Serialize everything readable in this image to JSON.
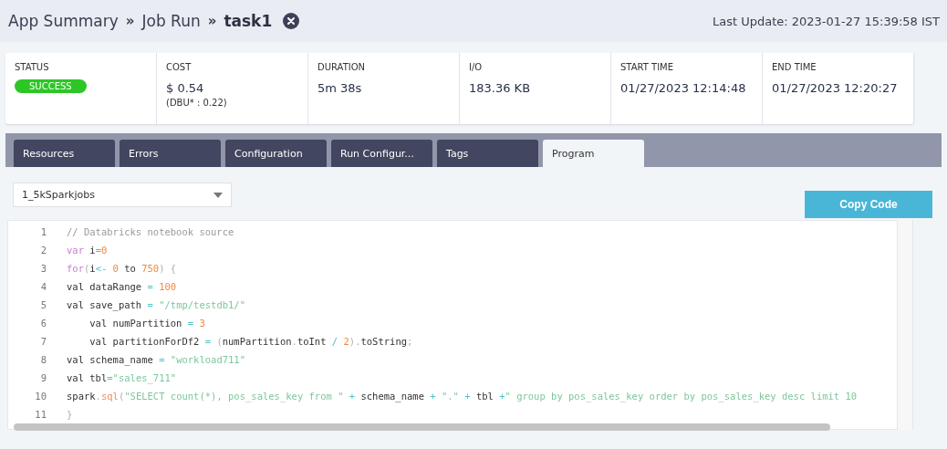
{
  "breadcrumb": [
    {
      "kind": "link",
      "text": "App Summary"
    },
    {
      "kind": "separator",
      "text": "»"
    },
    {
      "kind": "link",
      "text": "Job Run"
    },
    {
      "kind": "separator",
      "text": "»"
    },
    {
      "kind": "current",
      "text": "task1"
    }
  ],
  "last_update": "Last Update: 2023-01-27 15:39:58 IST",
  "stats": [
    {
      "kind": "badge",
      "label": "STATUS",
      "value": "SUCCESS",
      "color": "#2ec627"
    },
    {
      "kind": "text",
      "label": "COST",
      "value": "$ 0.54",
      "sub": "(DBU* : 0.22)"
    },
    {
      "kind": "text",
      "label": "DURATION",
      "value": "5m 38s"
    },
    {
      "kind": "text",
      "label": "I/O",
      "value": "183.36 KB"
    },
    {
      "kind": "text",
      "label": "START TIME",
      "value": "01/27/2023 12:14:48"
    },
    {
      "kind": "text",
      "label": "END TIME",
      "value": "01/27/2023 12:20:27"
    }
  ],
  "tabs": [
    {
      "label": "Resources",
      "selected": false
    },
    {
      "label": "Errors",
      "selected": false
    },
    {
      "label": "Configuration",
      "selected": false
    },
    {
      "label": "Run Configur...",
      "selected": false
    },
    {
      "label": "Tags",
      "selected": false
    },
    {
      "label": "Program",
      "selected": true
    }
  ],
  "program_select": {
    "value": "1_5kSparkjobs"
  },
  "copy_button": "Copy Code",
  "code_lines": [
    {
      "number": "1",
      "tokens": [
        {
          "kind": "comment",
          "text": "// Databricks notebook source"
        }
      ]
    },
    {
      "number": "2",
      "tokens": [
        {
          "kind": "keyword",
          "text": "var"
        },
        {
          "kind": "plain",
          "text": " i"
        },
        {
          "kind": "operator",
          "text": "="
        },
        {
          "kind": "number",
          "text": "0"
        }
      ]
    },
    {
      "number": "3",
      "tokens": [
        {
          "kind": "keyword",
          "text": "for"
        },
        {
          "kind": "punct",
          "text": "("
        },
        {
          "kind": "plain",
          "text": "i"
        },
        {
          "kind": "operator",
          "text": "<- "
        },
        {
          "kind": "number",
          "text": "0"
        },
        {
          "kind": "plain",
          "text": " to "
        },
        {
          "kind": "number",
          "text": "750"
        },
        {
          "kind": "punct",
          "text": ") {"
        }
      ]
    },
    {
      "number": "4",
      "tokens": [
        {
          "kind": "plain",
          "text": "val dataRange "
        },
        {
          "kind": "operator",
          "text": "= "
        },
        {
          "kind": "number",
          "text": "100"
        }
      ]
    },
    {
      "number": "5",
      "tokens": [
        {
          "kind": "plain",
          "text": "val save_path "
        },
        {
          "kind": "operator",
          "text": "= "
        },
        {
          "kind": "string",
          "text": "\"/tmp/testdb1/\""
        }
      ]
    },
    {
      "number": "6",
      "tokens": [
        {
          "kind": "plain",
          "text": "    val numPartition "
        },
        {
          "kind": "operator",
          "text": "= "
        },
        {
          "kind": "number",
          "text": "3"
        }
      ]
    },
    {
      "number": "7",
      "tokens": [
        {
          "kind": "plain",
          "text": "    val partitionForDf2 "
        },
        {
          "kind": "operator",
          "text": "= "
        },
        {
          "kind": "punct",
          "text": "("
        },
        {
          "kind": "plain",
          "text": "numPartition"
        },
        {
          "kind": "punct",
          "text": "."
        },
        {
          "kind": "plain",
          "text": "toInt "
        },
        {
          "kind": "operator",
          "text": "/ "
        },
        {
          "kind": "number",
          "text": "2"
        },
        {
          "kind": "punct",
          "text": ")."
        },
        {
          "kind": "plain",
          "text": "toString"
        },
        {
          "kind": "punct",
          "text": ";"
        }
      ]
    },
    {
      "number": "8",
      "tokens": [
        {
          "kind": "plain",
          "text": "val schema_name "
        },
        {
          "kind": "operator",
          "text": "= "
        },
        {
          "kind": "string",
          "text": "\"workload711\""
        }
      ]
    },
    {
      "number": "9",
      "tokens": [
        {
          "kind": "plain",
          "text": "val tbl"
        },
        {
          "kind": "operator",
          "text": "="
        },
        {
          "kind": "string",
          "text": "\"sales_711\""
        }
      ]
    },
    {
      "number": "10",
      "tokens": [
        {
          "kind": "plain",
          "text": "spark"
        },
        {
          "kind": "punct",
          "text": "."
        },
        {
          "kind": "function",
          "text": "sql"
        },
        {
          "kind": "punct",
          "text": "("
        },
        {
          "kind": "string",
          "text": "\"SELECT count(*), pos_sales_key from \""
        },
        {
          "kind": "operator",
          "text": " +"
        },
        {
          "kind": "plain",
          "text": " schema_name "
        },
        {
          "kind": "operator",
          "text": "+ "
        },
        {
          "kind": "string",
          "text": "\".\""
        },
        {
          "kind": "operator",
          "text": " +"
        },
        {
          "kind": "plain",
          "text": " tbl "
        },
        {
          "kind": "operator",
          "text": "+"
        },
        {
          "kind": "string",
          "text": "\" group by pos_sales_key order by pos_sales_key desc limit 10"
        }
      ]
    },
    {
      "number": "11",
      "tokens": [
        {
          "kind": "punct",
          "text": "}"
        }
      ]
    }
  ]
}
